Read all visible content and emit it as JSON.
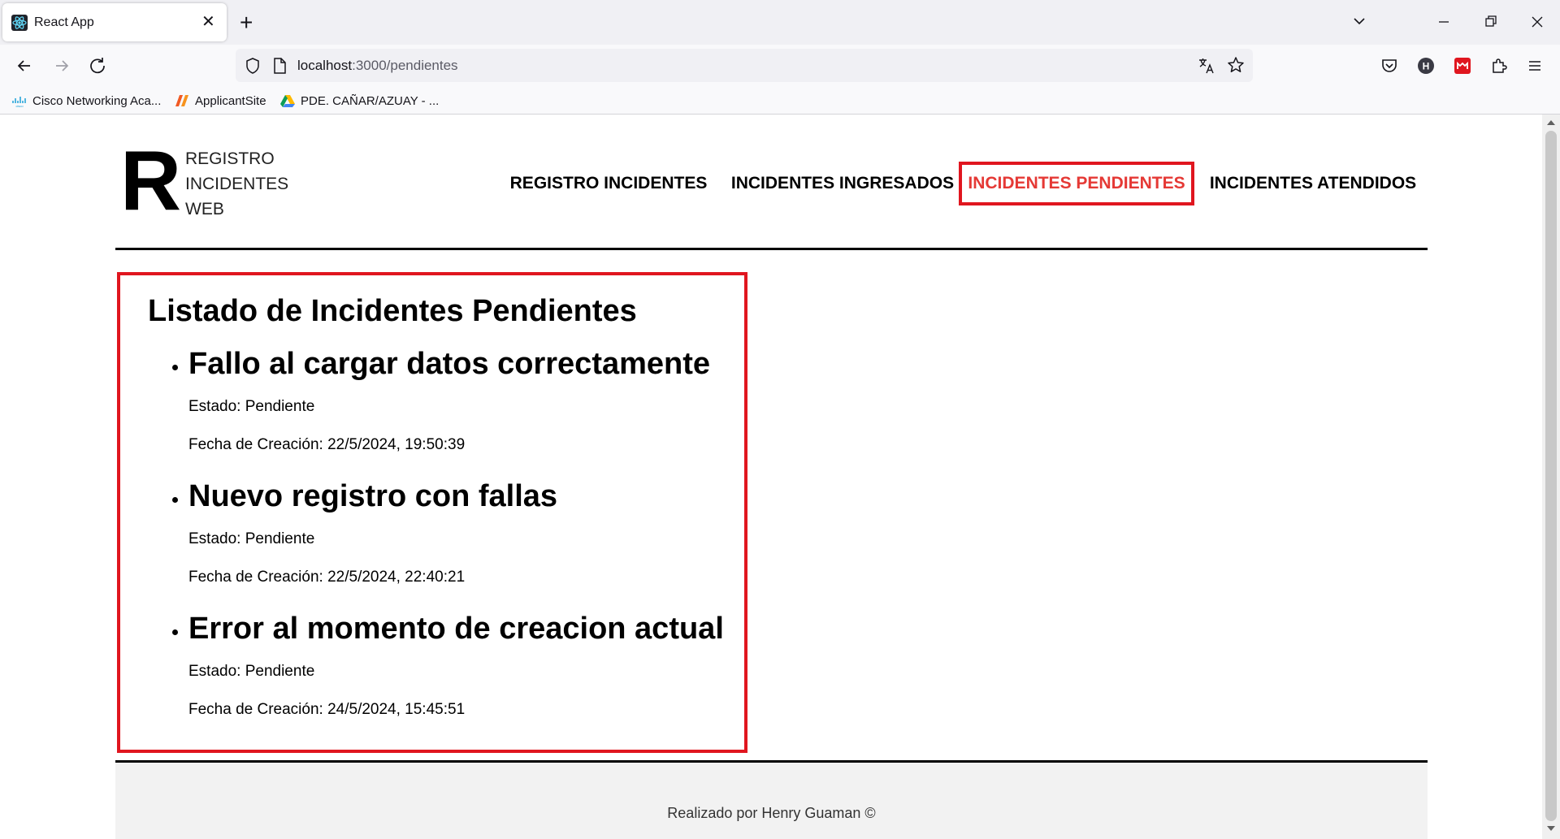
{
  "browser": {
    "tab": {
      "title": "React App"
    },
    "url": {
      "host": "localhost",
      "path": ":3000/pendientes"
    },
    "bookmarks": [
      {
        "label": "Cisco Networking Aca..."
      },
      {
        "label": "ApplicantSite"
      },
      {
        "label": "PDE. CAÑAR/AZUAY - ..."
      }
    ],
    "extension_badge": "H"
  },
  "logo": {
    "letter": "R",
    "lines": [
      "REGISTRO",
      "INCIDENTES",
      "WEB"
    ]
  },
  "nav": {
    "items": [
      {
        "label": "REGISTRO INCIDENTES",
        "active": false
      },
      {
        "label": "INCIDENTES INGRESADOS",
        "active": false
      },
      {
        "label": "INCIDENTES PENDIENTES",
        "active": true
      },
      {
        "label": "INCIDENTES ATENDIDOS",
        "active": false
      }
    ]
  },
  "main": {
    "title": "Listado de Incidentes Pendientes",
    "incidents": [
      {
        "title": "Fallo al cargar datos correctamente",
        "estado": "Estado: Pendiente",
        "fecha": "Fecha de Creación: 22/5/2024, 19:50:39"
      },
      {
        "title": "Nuevo registro con fallas",
        "estado": "Estado: Pendiente",
        "fecha": "Fecha de Creación: 22/5/2024, 22:40:21"
      },
      {
        "title": "Error al momento de creacion actual",
        "estado": "Estado: Pendiente",
        "fecha": "Fecha de Creación: 24/5/2024, 15:45:51"
      }
    ]
  },
  "footer": {
    "text": "Realizado por Henry Guaman ©"
  },
  "colors": {
    "accent": "#e0161f",
    "active_text": "#e53935"
  }
}
